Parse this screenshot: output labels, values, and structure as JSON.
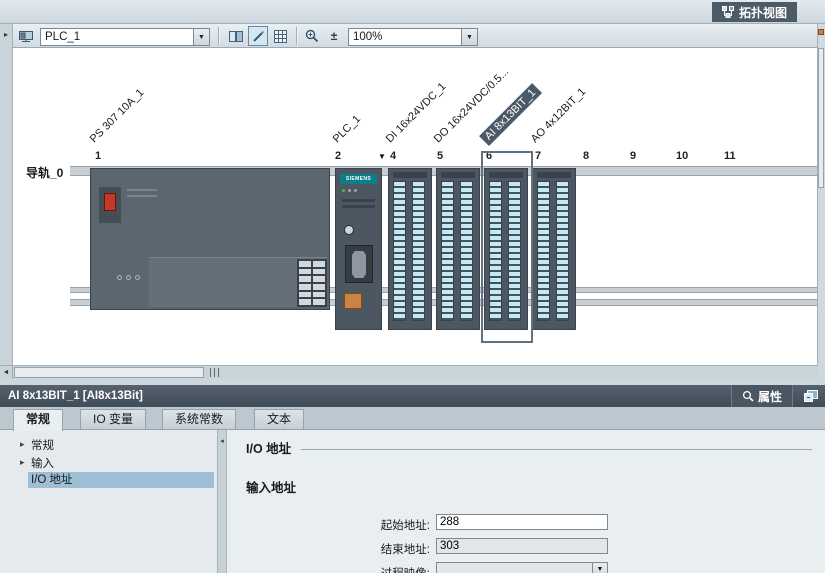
{
  "icons": {
    "dropdown": "▼",
    "collapse": "▸",
    "scroll_left": "◄",
    "splitter_left": "◂",
    "zoom_pm": "±",
    "slot_filter": "▼",
    "nav_expand": "▸"
  },
  "topbar": {
    "topology_tab": "拓扑视图"
  },
  "toolbar": {
    "device_select": "PLC_1",
    "zoom_select": "100%"
  },
  "device_view": {
    "rail_label": "导轨_0",
    "plc_logo": "SIEMENS",
    "slots": [
      "1",
      "2",
      "4",
      "5",
      "6",
      "7",
      "8",
      "9",
      "10",
      "11"
    ],
    "modules": [
      {
        "label": "PS 307 10A_1",
        "selected": false
      },
      {
        "label": "PLC_1",
        "selected": false
      },
      {
        "label": "DI 16x24VDC_1",
        "selected": false
      },
      {
        "label": "DO 16x24VDC/0.5...",
        "selected": false
      },
      {
        "label": "AI 8x13BIT_1",
        "selected": true
      },
      {
        "label": "AO 4x12BIT_1",
        "selected": false
      }
    ]
  },
  "inspector": {
    "title": "AI 8x13BIT_1 [AI8x13Bit]",
    "properties_tab": "属性",
    "tabs": [
      {
        "label": "常规",
        "selected": true
      },
      {
        "label": "IO 变量",
        "selected": false
      },
      {
        "label": "系统常数",
        "selected": false
      },
      {
        "label": "文本",
        "selected": false
      }
    ],
    "nav": [
      {
        "label": "常规",
        "selected": false
      },
      {
        "label": "输入",
        "selected": false
      },
      {
        "label": "I/O 地址",
        "selected": true
      }
    ],
    "section_title": "I/O 地址",
    "subsection_title": "输入地址",
    "fields": [
      {
        "label": "起始地址:",
        "value": "288"
      },
      {
        "label": "结束地址:",
        "value": "303"
      },
      {
        "label": "过程映像:",
        "value": ""
      }
    ]
  },
  "colors": {
    "inspector_header_bg": "#47535f",
    "nav_selection": "#9dbed4",
    "module_stripe": "#c3e9f2",
    "module_body": "#4d5761",
    "orange_connector": "#cb8243",
    "topology_tab_bg": "#4d5b67"
  }
}
